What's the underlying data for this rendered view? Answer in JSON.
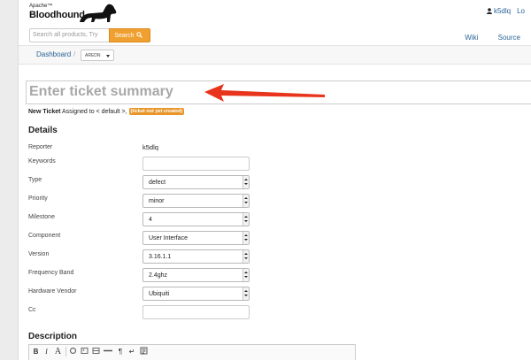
{
  "header": {
    "logo_small": "Apache™",
    "logo_big": "Bloodhound",
    "user": "k5dlq",
    "logout": "Lo",
    "search_placeholder": "Search all products, Try",
    "search_button": "Search",
    "links": [
      "Wiki",
      "Source"
    ]
  },
  "breadcrumb": {
    "dashboard": "Dashboard",
    "separator": "/",
    "product": "AREDN"
  },
  "ticket": {
    "summary_placeholder": "Enter ticket summary",
    "new_ticket_label": "New Ticket",
    "assigned_text": "Assigned to < default >,",
    "status_badge": "(ticket not yet created)"
  },
  "details": {
    "heading": "Details",
    "reporter_label": "Reporter",
    "reporter_value": "k5dlq",
    "keywords_label": "Keywords",
    "type_label": "Type",
    "type_value": "defect",
    "priority_label": "Priority",
    "priority_value": "minor",
    "milestone_label": "Milestone",
    "milestone_value": "4",
    "component_label": "Component",
    "component_value": "User Interface",
    "version_label": "Version",
    "version_value": "3.16.1.1",
    "frequency_label": "Frequency Band",
    "frequency_value": "2.4ghz",
    "vendor_label": "Hardware Vendor",
    "vendor_value": "Ubiquiti",
    "cc_label": "Cc"
  },
  "description": {
    "heading": "Description",
    "toolbar": [
      "B",
      "I",
      "A",
      "¶",
      "↵"
    ]
  },
  "colors": {
    "link": "#2a6496",
    "search_button": "#f0a030",
    "badge": "#e8962a",
    "arrow": "#e8341c"
  }
}
